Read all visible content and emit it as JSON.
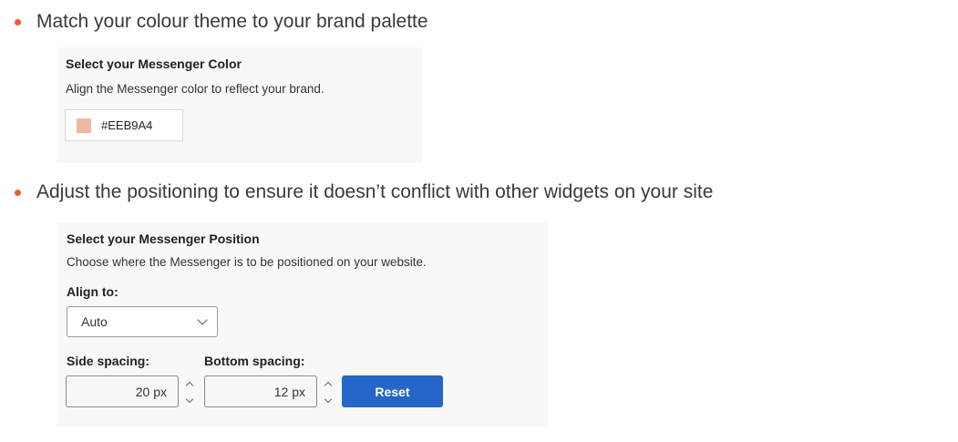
{
  "colors": {
    "bullet": "#f05a28",
    "panel_bg": "#f8f8f8",
    "swatch": "#EEB9A4",
    "accent": "#2566c8"
  },
  "bullets": [
    {
      "text": "Match your colour theme to your brand palette"
    },
    {
      "text": "Adjust the positioning to ensure it doesn’t conflict with other widgets on your site"
    }
  ],
  "color_panel": {
    "title": "Select your Messenger Color",
    "description": "Align the Messenger color to reflect your brand.",
    "color_value": "#EEB9A4"
  },
  "position_panel": {
    "title": "Select your Messenger Position",
    "description": "Choose where the Messenger is to be positioned on your website.",
    "align_label": "Align to:",
    "align_value": "Auto",
    "side_label": "Side spacing:",
    "side_value": "20 px",
    "bottom_label": "Bottom spacing:",
    "bottom_value": "12 px",
    "reset_label": "Reset"
  }
}
